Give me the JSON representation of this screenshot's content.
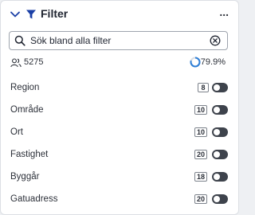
{
  "header": {
    "collapse_icon": "chevron-down-icon",
    "filter_icon": "funnel-icon",
    "title": "Filter",
    "more_label": "...",
    "accent_color": "#1a3fa6"
  },
  "search": {
    "value": "Sök bland alla filter",
    "search_icon": "search-icon",
    "clear_icon": "clear-circle-icon"
  },
  "stats": {
    "users_icon": "users-icon",
    "count": "5275",
    "progress_icon": "progress-ring-icon",
    "percent": "79.9%",
    "percent_value": 0.799,
    "progress_color": "#2f7fd6"
  },
  "filters": [
    {
      "label": "Region",
      "count": "8",
      "enabled": false
    },
    {
      "label": "Område",
      "count": "10",
      "enabled": false
    },
    {
      "label": "Ort",
      "count": "10",
      "enabled": false
    },
    {
      "label": "Fastighet",
      "count": "20",
      "enabled": false
    },
    {
      "label": "Byggår",
      "count": "18",
      "enabled": false
    },
    {
      "label": "Gatuadress",
      "count": "20",
      "enabled": false
    }
  ]
}
